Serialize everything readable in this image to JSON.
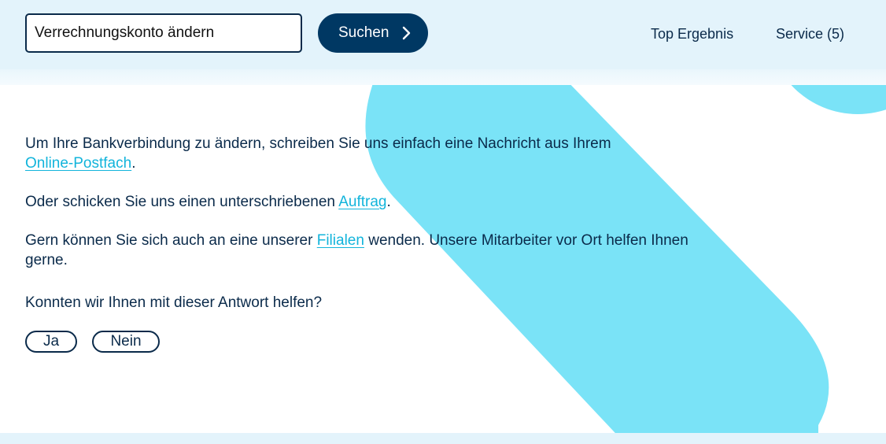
{
  "search": {
    "value": "Verrechnungskonto ändern",
    "button_label": "Suchen"
  },
  "tabs": [
    {
      "label": "Top Ergebnis"
    },
    {
      "label": "Service (5)"
    }
  ],
  "answer": {
    "p1_text": "Um Ihre Bankverbindung zu ändern, schreiben Sie uns einfach eine Nachricht aus Ihrem",
    "p1_link": "Online-Postfach",
    "p1_end": ".",
    "p2_text": "Oder schicken Sie uns einen unterschriebenen",
    "p2_link": "Auftrag",
    "p2_end": ".",
    "p3_text": "Gern können Sie sich auch an eine unserer",
    "p3_link": "Filialen",
    "p3_end": "wenden. Unsere Mitarbeiter vor Ort helfen Ihnen gerne."
  },
  "feedback": {
    "question": "Konnten wir Ihnen mit dieser Antwort helfen?",
    "yes_label": "Ja",
    "no_label": "Nein"
  },
  "colors": {
    "accent_cyan": "#7ae3f7",
    "link": "#12b4db",
    "navy": "#003863",
    "header_bg": "#e3f3fb"
  },
  "icons": {
    "search_button_icon": "chevron-right-icon"
  }
}
